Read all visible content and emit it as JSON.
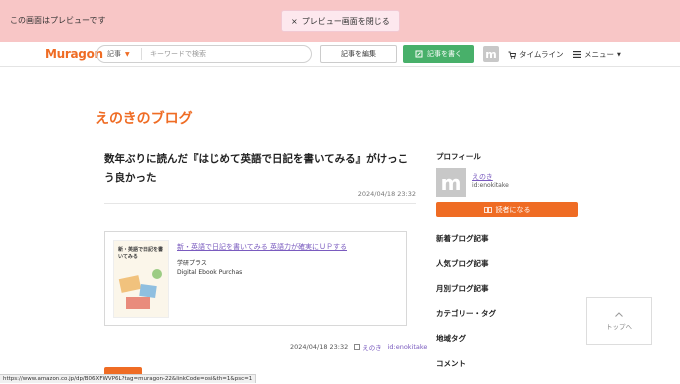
{
  "preview_bar": {
    "label": "この画面はプレビューです",
    "close_label": "プレビュー画面を閉じる",
    "close_icon": "×"
  },
  "nav": {
    "logo": "Muragon",
    "search_category": "記事",
    "search_placeholder": "キーワードで検索",
    "edit_label": "記事を編集",
    "write_label": "記事を書く",
    "avatar_letter": "m",
    "timeline_label": "タイムライン",
    "menu_label": "メニュー"
  },
  "blog": {
    "title": "えのきのブログ"
  },
  "post": {
    "title": "数年ぶりに読んだ『はじめて英語で日記を書いてみる』がけっこう良かった",
    "date_top": "2024/04/18 23:32",
    "amazon": {
      "book_cover_text": "新・英語で日記を書いてみる",
      "link_text": "新・英語で日記を書いてみる 英語力が確実にＵＰする",
      "publisher": "学研プラス",
      "format": "Digital Ebook Purchas"
    },
    "meta_date": "2024/04/18 23:32",
    "meta_author": "えのき",
    "meta_id": "id:enokitake"
  },
  "sidebar": {
    "profile_heading": "プロフィール",
    "avatar_letter": "m",
    "profile_name": "えのき",
    "profile_id": "id:enokitake",
    "subscribe_label": "読者になる",
    "sections": [
      "新着ブログ記事",
      "人気ブログ記事",
      "月別ブログ記事",
      "カテゴリー・タグ",
      "地域タグ",
      "コメント"
    ]
  },
  "to_top": {
    "label": "トップへ"
  },
  "status_bar": {
    "url": "https://www.amazon.co.jp/dp/B06XFWVP6L?tag=muragon-22&linkCode=osi&th=1&psc=1"
  },
  "colors": {
    "accent": "#ef6c24",
    "write_button": "#48b06a",
    "preview_bar": "#f8c6c6",
    "link": "#7a5bbf"
  }
}
